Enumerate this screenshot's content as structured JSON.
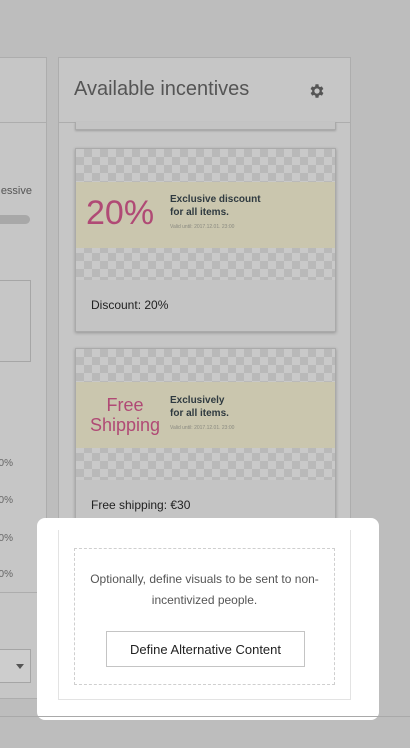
{
  "left_panel": {
    "label_partial": "essive",
    "percent_rows": [
      "0%",
      "0%",
      "0%",
      "0%"
    ]
  },
  "incentives_panel": {
    "title": "Available incentives",
    "settings_icon": "gear-icon",
    "cards": [
      {
        "visual_big_text": "20%",
        "visual_headline_line1": "Exclusive discount",
        "visual_headline_line2": "for all items.",
        "visual_valid": "Valid until: 2017.12.01. 23:00",
        "caption": "Discount: 20%"
      },
      {
        "visual_big_text_line1": "Free",
        "visual_big_text_line2": "Shipping",
        "visual_headline_line1": "Exclusively",
        "visual_headline_line2": "for all items.",
        "visual_valid": "Valid until: 2017.12.01. 23:00",
        "caption": "Free shipping: €30"
      }
    ],
    "alternative": {
      "description": "Optionally, define visuals to be sent to non-incentivized people.",
      "button_label": "Define Alternative Content"
    }
  },
  "colors": {
    "overlay_gray": "#bdbdbd",
    "highlight": "#ffffff",
    "accent_magenta": "#b04a75",
    "band": "#cac6ae"
  }
}
